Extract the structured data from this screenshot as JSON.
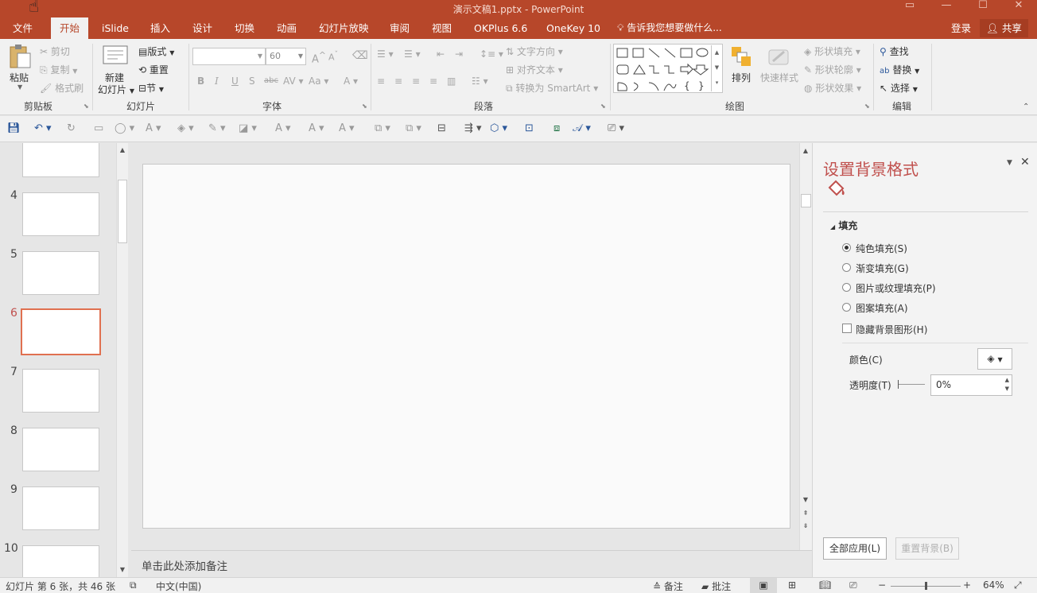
{
  "titlebar": {
    "title": "演示文稿1.pptx - PowerPoint"
  },
  "tabs": [
    "文件",
    "开始",
    "iSlide",
    "插入",
    "设计",
    "切换",
    "动画",
    "幻灯片放映",
    "审阅",
    "视图",
    "OKPlus 6.6",
    "OneKey 10"
  ],
  "tellme": "告诉我您想要做什么...",
  "account": {
    "login": "登录",
    "share": "共享"
  },
  "ribbon": {
    "clipboard": {
      "paste": "粘贴",
      "cut": "剪切",
      "copy": "复制",
      "format_painter": "格式刷",
      "label": "剪贴板"
    },
    "slides": {
      "new_slide_1": "新建",
      "new_slide_2": "幻灯片",
      "layout": "版式",
      "reset": "重置",
      "section": "节",
      "label": "幻灯片"
    },
    "font": {
      "font_size": "60",
      "label": "字体"
    },
    "paragraph": {
      "text_direction": "文字方向",
      "align_text": "对齐文本",
      "smartart": "转换为 SmartArt",
      "label": "段落"
    },
    "drawing": {
      "arrange": "排列",
      "quick_styles": "快速样式",
      "shape_fill": "形状填充",
      "shape_outline": "形状轮廓",
      "shape_effects": "形状效果",
      "label": "绘图"
    },
    "editing": {
      "find": "查找",
      "replace": "替换",
      "select": "选择",
      "label": "编辑"
    }
  },
  "thumbnails": {
    "numbers": [
      "4",
      "5",
      "6",
      "7",
      "8",
      "9",
      "10"
    ],
    "selected": "6"
  },
  "notes": {
    "placeholder": "单击此处添加备注"
  },
  "format_pane": {
    "title": "设置背景格式",
    "section": "填充",
    "options": [
      "纯色填充(S)",
      "渐变填充(G)",
      "图片或纹理填充(P)",
      "图案填充(A)"
    ],
    "selected_option": "纯色填充(S)",
    "hide_background": "隐藏背景图形(H)",
    "color_label": "颜色(C)",
    "transparency_label": "透明度(T)",
    "transparency_value": "0%",
    "apply_all": "全部应用(L)",
    "reset_background": "重置背景(B)"
  },
  "status": {
    "slide_info": "幻灯片 第 6 张，共 46 张",
    "language": "中文(中国)",
    "notes": "备注",
    "comments": "批注",
    "zoom": "64%"
  },
  "colors": {
    "accent": "#b7472a",
    "pane_title": "#c0504d"
  }
}
